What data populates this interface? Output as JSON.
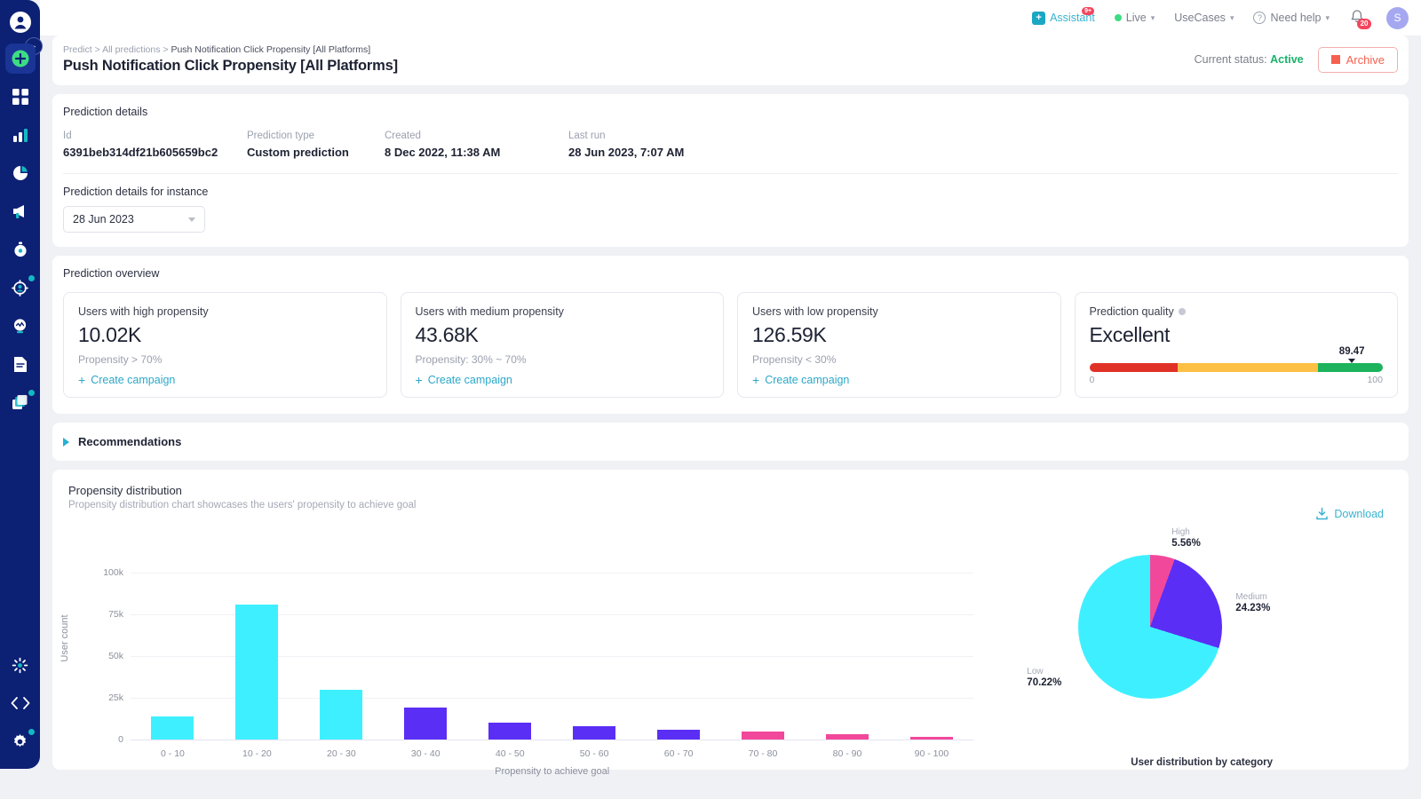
{
  "topbar": {
    "assistant": {
      "label": "Assistant",
      "badge": "9+",
      "icon": "assistant-icon"
    },
    "live": {
      "label": "Live",
      "caret": "⌄"
    },
    "usecases": {
      "label": "UseCases",
      "caret": "⌄"
    },
    "help": {
      "label": "Need help",
      "caret": "⌄"
    },
    "notifications": {
      "count": "20",
      "icon": "bell-icon"
    },
    "avatar": {
      "initial": "S"
    }
  },
  "rail": {
    "items": [
      {
        "name": "logo",
        "icon": "clevertap-logo-icon"
      },
      {
        "name": "add",
        "icon": "plus-circle-icon"
      },
      {
        "name": "dashboard",
        "icon": "dashboard-grid-icon"
      },
      {
        "name": "analytics",
        "icon": "bar-chart-icon"
      },
      {
        "name": "segments",
        "icon": "pie-chart-icon"
      },
      {
        "name": "campaigns",
        "icon": "megaphone-icon"
      },
      {
        "name": "journeys",
        "icon": "stopwatch-icon"
      },
      {
        "name": "targeting",
        "icon": "target-user-icon"
      },
      {
        "name": "predict",
        "icon": "brain-icon"
      },
      {
        "name": "reports",
        "icon": "document-icon"
      },
      {
        "name": "boards",
        "icon": "layers-icon"
      },
      {
        "name": "integrations",
        "icon": "sparkle-icon"
      },
      {
        "name": "developer",
        "icon": "code-icon"
      },
      {
        "name": "settings",
        "icon": "gear-icon"
      }
    ]
  },
  "header": {
    "breadcrumb": {
      "root": "Predict",
      "sep1": ">",
      "mid": "All predictions",
      "sep2": ">",
      "current": "Push Notification Click Propensity [All Platforms]"
    },
    "title": "Push Notification Click Propensity [All Platforms]",
    "status_label": "Current status:",
    "status_value": "Active",
    "archive_label": "Archive"
  },
  "details": {
    "section_title": "Prediction details",
    "fields": [
      {
        "label": "Id",
        "value": "6391beb314df21b605659bc2"
      },
      {
        "label": "Prediction type",
        "value": "Custom prediction"
      },
      {
        "label": "Created",
        "value": "8 Dec 2022, 11:38 AM"
      },
      {
        "label": "Last run",
        "value": "28 Jun 2023, 7:07 AM"
      }
    ],
    "instance_label": "Prediction details for instance",
    "instance_value": "28 Jun 2023"
  },
  "overview": {
    "section_title": "Prediction overview",
    "cards": [
      {
        "label": "Users with high propensity",
        "value": "10.02K",
        "sub": "Propensity > 70%",
        "link": "Create campaign"
      },
      {
        "label": "Users with medium propensity",
        "value": "43.68K",
        "sub": "Propensity: 30% ~ 70%",
        "link": "Create campaign"
      },
      {
        "label": "Users with low propensity",
        "value": "126.59K",
        "sub": "Propensity < 30%",
        "link": "Create campaign"
      }
    ],
    "quality": {
      "label": "Prediction quality",
      "value": "Excellent",
      "score": "89.47",
      "scale_min": "0",
      "scale_max": "100",
      "colors": {
        "red": "#e03127",
        "yellow": "#fcc044",
        "green": "#1cb35c"
      }
    }
  },
  "recommendations": {
    "label": "Recommendations"
  },
  "chart_section": {
    "title": "Propensity distribution",
    "subtitle": "Propensity distribution chart showcases the users' propensity to achieve goal",
    "download_label": "Download"
  },
  "chart_data": [
    {
      "type": "bar",
      "title": "Propensity distribution",
      "xlabel": "Propensity to achieve goal",
      "ylabel": "User count",
      "categories": [
        "0 - 10",
        "10 - 20",
        "20 - 30",
        "30 - 40",
        "40 - 50",
        "50 - 60",
        "60 - 70",
        "70 - 80",
        "80 - 90",
        "90 - 100"
      ],
      "values": [
        14000,
        81000,
        30000,
        19000,
        10000,
        8000,
        6000,
        5000,
        3000,
        1500
      ],
      "bar_colors": [
        "#3ef0ff",
        "#3ef0ff",
        "#3ef0ff",
        "#5b2ef5",
        "#5b2ef5",
        "#5b2ef5",
        "#5b2ef5",
        "#f2489b",
        "#f2489b",
        "#f2489b"
      ],
      "ylim": [
        0,
        100000
      ],
      "yticks": [
        "0",
        "25k",
        "50k",
        "75k",
        "100k"
      ],
      "ytick_values": [
        0,
        25000,
        50000,
        75000,
        100000
      ],
      "grid": true,
      "legend": false
    },
    {
      "type": "pie",
      "title": "User distribution by category",
      "labels": [
        "High",
        "Medium",
        "Low"
      ],
      "values": [
        5.56,
        24.23,
        70.22
      ],
      "value_labels": [
        "5.56%",
        "24.23%",
        "70.22%"
      ],
      "colors": [
        "#f2489b",
        "#5b2ef5",
        "#3ef0ff"
      ],
      "legend": "annotations"
    }
  ]
}
